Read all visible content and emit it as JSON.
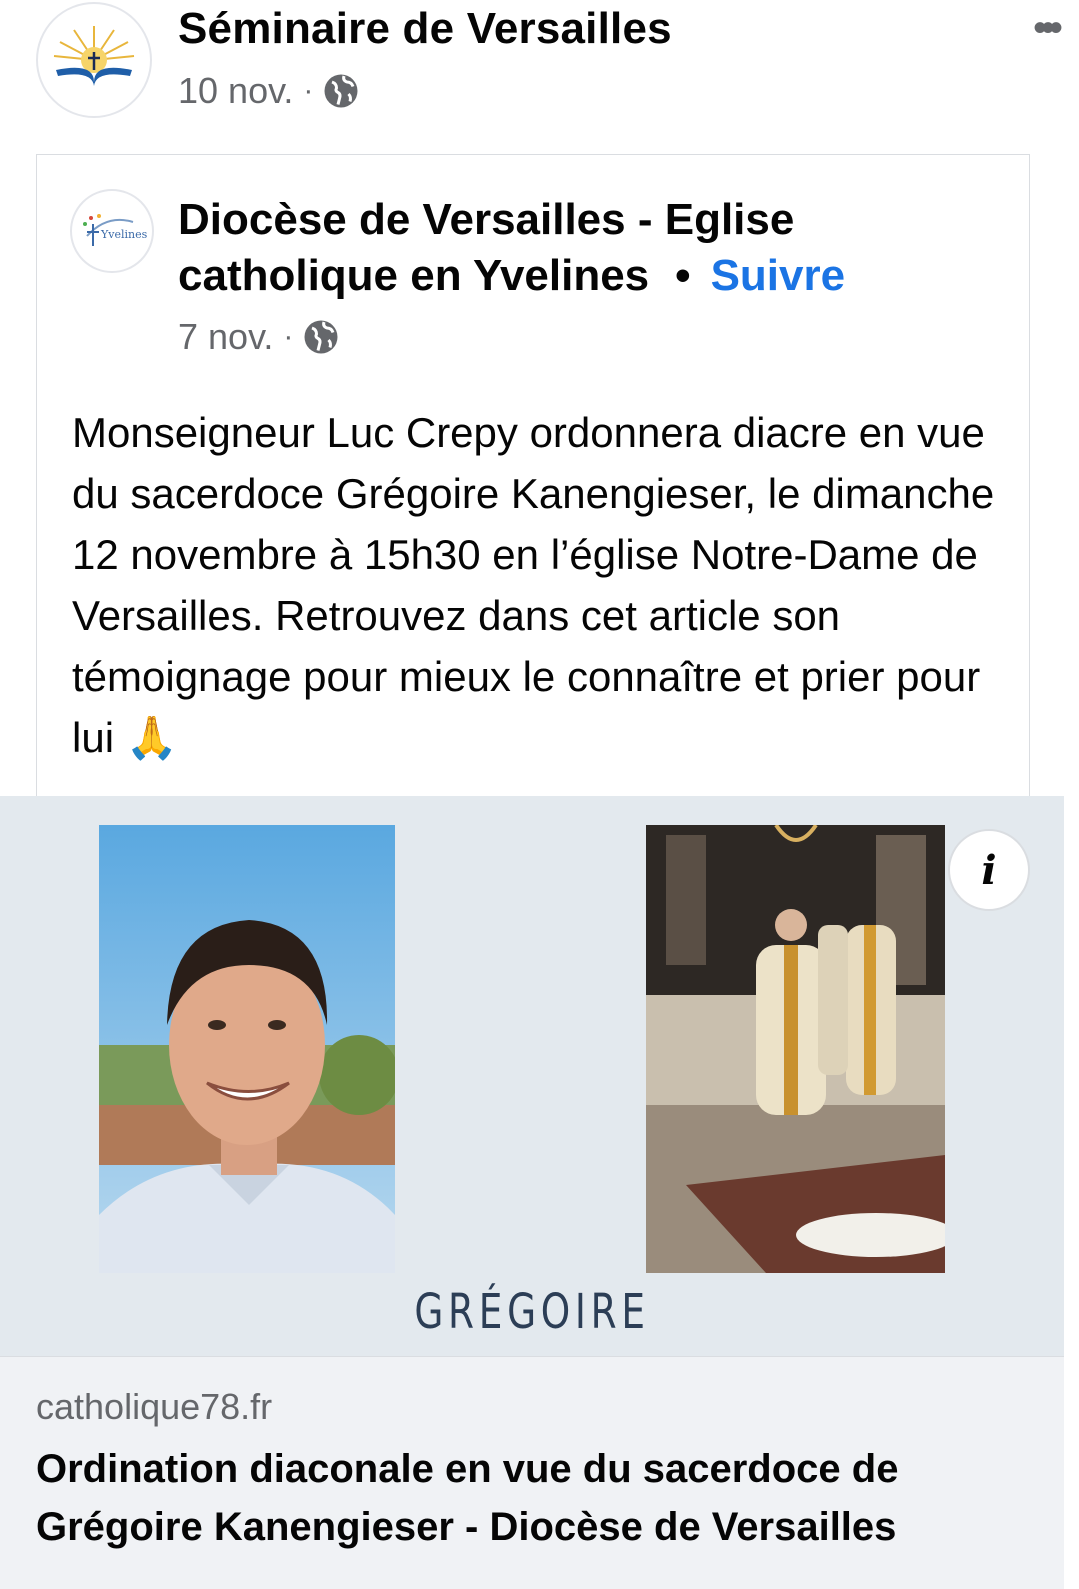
{
  "post": {
    "author": "Séminaire de Versailles",
    "date": "10 nov.",
    "meta_sep": "·",
    "more_label": "•••"
  },
  "shared": {
    "author": "Diocèse de Versailles - Eglise catholique en Yvelines",
    "separator": "•",
    "follow_label": "Suivre",
    "date": "7 nov.",
    "meta_sep": "·",
    "text": "Monseigneur Luc Crepy ordonnera diacre en vue du sacerdoce Grégoire Kanengieser, le dimanche 12 novembre à 15h30 en l’église Notre-Dame de Versailles. Retrouvez dans cet article son témoignage pour mieux le connaître et prier pour lui 🙏",
    "avatar_logo_text": "Yvelines"
  },
  "preview": {
    "caption": "GRÉGOIRE",
    "info_label": "i",
    "domain": "catholique78.fr",
    "title": "Ordination diaconale en vue du sacerdoce de Grégoire Kanengieser - Diocèse de Versailles"
  },
  "colors": {
    "link_blue": "#1b74e4",
    "meta_gray": "#65676b",
    "preview_bg": "#e3e9ee",
    "caption_color": "#2c3e56"
  },
  "icons": {
    "globe": "globe-icon",
    "more": "more-options-icon",
    "info": "info-icon"
  }
}
